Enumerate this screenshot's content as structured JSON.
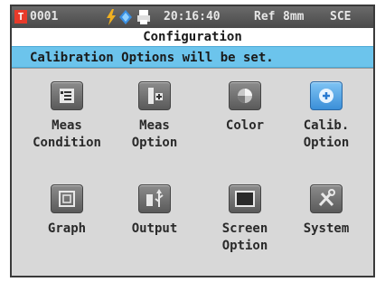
{
  "status_bar": {
    "sample_id": "0001",
    "time": "20:16:40",
    "reference": "Ref",
    "aperture": "8mm",
    "mode": "SCE",
    "icons": [
      "sample-id-icon",
      "power-icon",
      "bluetooth-icon",
      "printer-icon"
    ]
  },
  "title": "Configuration",
  "message": "Calibration Options will be set.",
  "menu": {
    "items": [
      {
        "label": "Meas\nCondition",
        "icon": "meas-condition-icon"
      },
      {
        "label": "Meas\nOption",
        "icon": "meas-option-icon"
      },
      {
        "label": "Color",
        "icon": "color-icon"
      },
      {
        "label": "Calib.\nOption",
        "icon": "calib-option-icon",
        "selected": true
      },
      {
        "label": "Graph",
        "icon": "graph-icon"
      },
      {
        "label": "Output",
        "icon": "output-icon"
      },
      {
        "label": "Screen\nOption",
        "icon": "screen-option-icon"
      },
      {
        "label": "System",
        "icon": "system-icon"
      }
    ]
  },
  "colors": {
    "message_bar": "#6cc4ec",
    "status_bar": "#555555",
    "panel": "#d8d8d8",
    "selected_icon": "#4a9fe0",
    "sample_id_badge": "#e83a2a"
  }
}
